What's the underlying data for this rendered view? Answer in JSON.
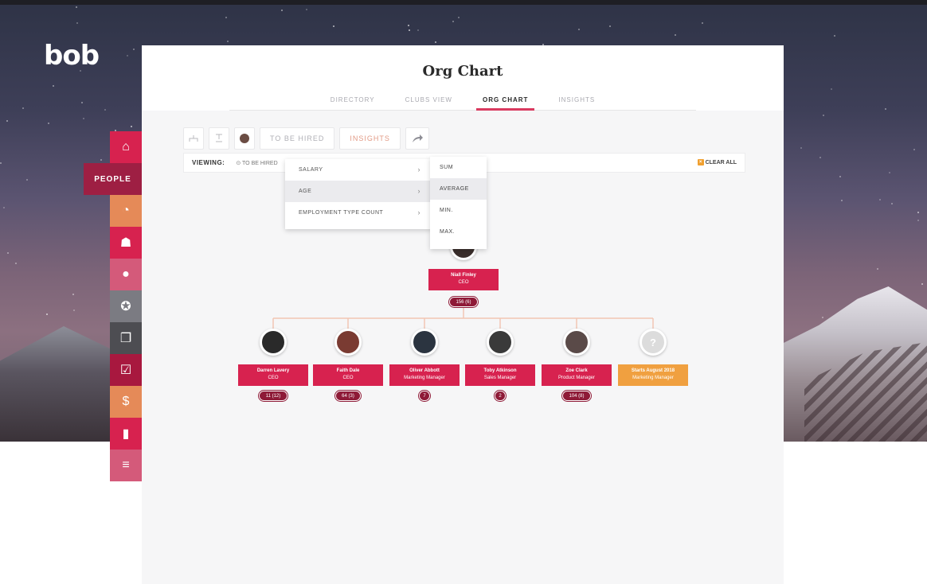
{
  "app": {
    "logo": "bob"
  },
  "sidebar": {
    "active_label": "PEOPLE",
    "items": [
      {
        "icon": "home-icon",
        "color": "#d7224f",
        "glyph": "⌂"
      },
      {
        "icon": "timer-icon",
        "color": "#e58a58",
        "glyph": "◔"
      },
      {
        "icon": "user-group-icon",
        "color": "#d7224f",
        "glyph": "☗"
      },
      {
        "icon": "chat-icon",
        "color": "#d45a7a",
        "glyph": "●"
      },
      {
        "icon": "award-icon",
        "color": "#7b7b82",
        "glyph": "✪"
      },
      {
        "icon": "documents-icon",
        "color": "#4d4d52",
        "glyph": "❐"
      },
      {
        "icon": "tasks-icon",
        "color": "#a8183f",
        "glyph": "☑"
      },
      {
        "icon": "money-icon",
        "color": "#e58a58",
        "glyph": "$"
      },
      {
        "icon": "analytics-icon",
        "color": "#d7224f",
        "glyph": "▮"
      },
      {
        "icon": "settings-sliders-icon",
        "color": "#d45a7a",
        "glyph": "≡"
      }
    ]
  },
  "header": {
    "title": "Org Chart",
    "tabs": [
      {
        "label": "DIRECTORY",
        "active": false
      },
      {
        "label": "CLUBS VIEW",
        "active": false
      },
      {
        "label": "ORG CHART",
        "active": true
      },
      {
        "label": "INSIGHTS",
        "active": false
      }
    ]
  },
  "toolbar": {
    "to_be_hired_label": "TO BE HIRED",
    "insights_label": "INSIGHTS"
  },
  "viewing": {
    "label": "VIEWING:",
    "chip": "TO BE HIRED",
    "clear_label": "CLEAR ALL"
  },
  "insights_menu": {
    "items": [
      {
        "label": "SALARY",
        "highlight": false
      },
      {
        "label": "AGE",
        "highlight": true
      },
      {
        "label": "EMPLOYMENT TYPE COUNT",
        "highlight": false
      }
    ],
    "submenu": [
      {
        "label": "SUM",
        "highlight": false
      },
      {
        "label": "AVERAGE",
        "highlight": true
      },
      {
        "label": "MIN.",
        "highlight": false
      },
      {
        "label": "MAX.",
        "highlight": false
      }
    ]
  },
  "org": {
    "root": {
      "name": "Niall Finley",
      "title": "CEO",
      "count": "156 (6)"
    },
    "children": [
      {
        "name": "Darren Lavery",
        "title": "CEO",
        "count": "11 (12)",
        "avatar_color": "#2a2a2a"
      },
      {
        "name": "Faith Dale",
        "title": "CEO",
        "count": "64 (3)",
        "avatar_color": "#7a3b32"
      },
      {
        "name": "Oliver Abbott",
        "title": "Marketing Manager",
        "count": "7",
        "avatar_color": "#2b3440"
      },
      {
        "name": "Toby Atkinson",
        "title": "Sales Manager",
        "count": "2",
        "avatar_color": "#3a3a3a"
      },
      {
        "name": "Zoe Clark",
        "title": "Product Manager",
        "count": "104 (8)",
        "avatar_color": "#5a4a48"
      },
      {
        "name": "Starts August 2018",
        "title": "Marketing Manager",
        "count": "",
        "avatar_color": "#dcdcdc",
        "placeholder": "?"
      }
    ]
  },
  "colors": {
    "brand_red": "#d7224f",
    "dark_red": "#8e1a37",
    "orange": "#f0a040",
    "people_tab": "#9e1f43"
  }
}
